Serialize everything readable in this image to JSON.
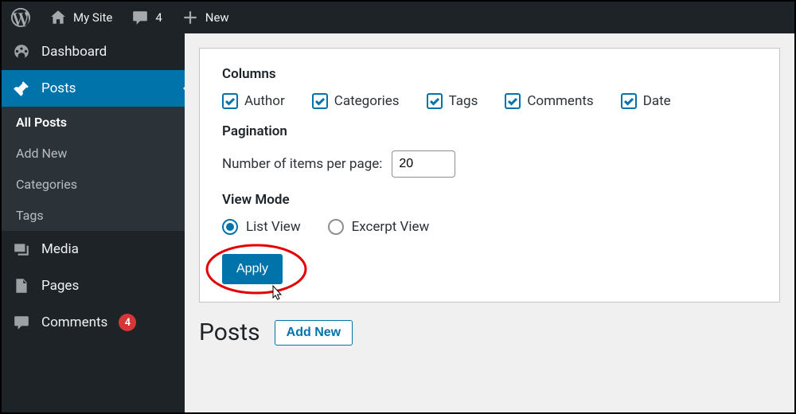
{
  "adminbar": {
    "site_name": "My Site",
    "comments_count": "4",
    "new_label": "New"
  },
  "sidebar": {
    "dashboard": "Dashboard",
    "posts": "Posts",
    "posts_sub": {
      "all_posts": "All Posts",
      "add_new": "Add New",
      "categories": "Categories",
      "tags": "Tags"
    },
    "media": "Media",
    "pages": "Pages",
    "comments": "Comments",
    "comments_badge": "4"
  },
  "screen_options": {
    "columns_heading": "Columns",
    "columns": {
      "author": "Author",
      "categories": "Categories",
      "tags": "Tags",
      "comments": "Comments",
      "date": "Date"
    },
    "pagination_heading": "Pagination",
    "per_page_label": "Number of items per page:",
    "per_page_value": "20",
    "view_mode_heading": "View Mode",
    "list_view": "List View",
    "excerpt_view": "Excerpt View",
    "apply": "Apply"
  },
  "page": {
    "title": "Posts",
    "add_new": "Add New"
  }
}
